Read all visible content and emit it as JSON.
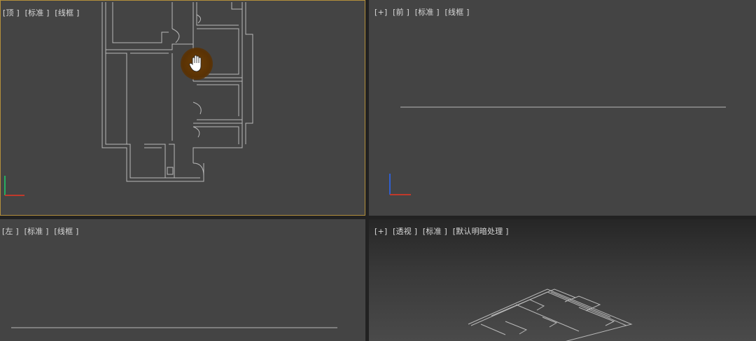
{
  "viewports": {
    "top": {
      "labels": [
        "[顶 ]",
        "[标准 ]",
        "[线框 ]"
      ],
      "active": true
    },
    "front": {
      "labels": [
        "[+]",
        "[前 ]",
        "[标准 ]",
        "[线框 ]"
      ]
    },
    "left": {
      "labels": [
        "[左 ]",
        "[标准 ]",
        "[线框 ]"
      ]
    },
    "perspective": {
      "labels": [
        "[+]",
        "[透视 ]",
        "[标准 ]",
        "[默认明暗处理 ]"
      ]
    }
  },
  "colors": {
    "viewport_bg": "#444444",
    "active_border": "#b38f3c",
    "wireframe": "#b9b9b9",
    "axis_x": "#c0392b",
    "axis_y": "#27ae60",
    "axis_z": "#2f5fd0",
    "pan_cursor": "#6b3e07"
  },
  "cursor": {
    "icon": "pan-hand-icon"
  }
}
